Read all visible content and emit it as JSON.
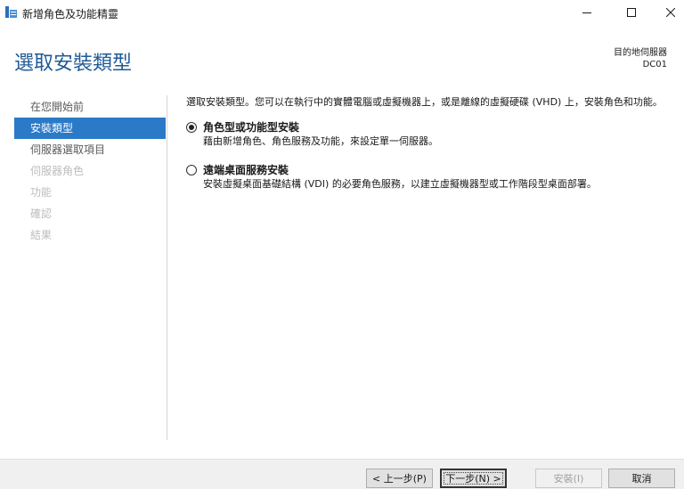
{
  "window": {
    "title": "新增角色及功能精靈",
    "icons": {
      "app": "server-manager-icon",
      "minimize": "minimize-icon",
      "maximize": "maximize-icon",
      "close": "close-icon"
    }
  },
  "header": {
    "title": "選取安裝類型",
    "destination_label": "目的地伺服器",
    "destination_server": "DC01"
  },
  "sidebar": {
    "items": [
      {
        "label": "在您開始前",
        "state": "normal"
      },
      {
        "label": "安裝類型",
        "state": "active"
      },
      {
        "label": "伺服器選取項目",
        "state": "normal"
      },
      {
        "label": "伺服器角色",
        "state": "disabled"
      },
      {
        "label": "功能",
        "state": "disabled"
      },
      {
        "label": "確認",
        "state": "disabled"
      },
      {
        "label": "結果",
        "state": "disabled"
      }
    ]
  },
  "content": {
    "intro": "選取安裝類型。您可以在執行中的實體電腦或虛擬機器上，或是離線的虛擬硬碟 (VHD) 上，安裝角色和功能。",
    "options": [
      {
        "title": "角色型或功能型安裝",
        "description": "藉由新增角色、角色服務及功能，來設定單一伺服器。",
        "selected": true
      },
      {
        "title": "遠端桌面服務安裝",
        "description": "安裝虛擬桌面基礎結構 (VDI) 的必要角色服務，以建立虛擬機器型或工作階段型桌面部署。",
        "selected": false
      }
    ]
  },
  "footer": {
    "previous": "< 上一步(P)",
    "next": "下一步(N) >",
    "install": "安裝(I)",
    "cancel": "取消"
  },
  "colors": {
    "accent": "#2a7ac7",
    "title": "#1f5a96"
  }
}
